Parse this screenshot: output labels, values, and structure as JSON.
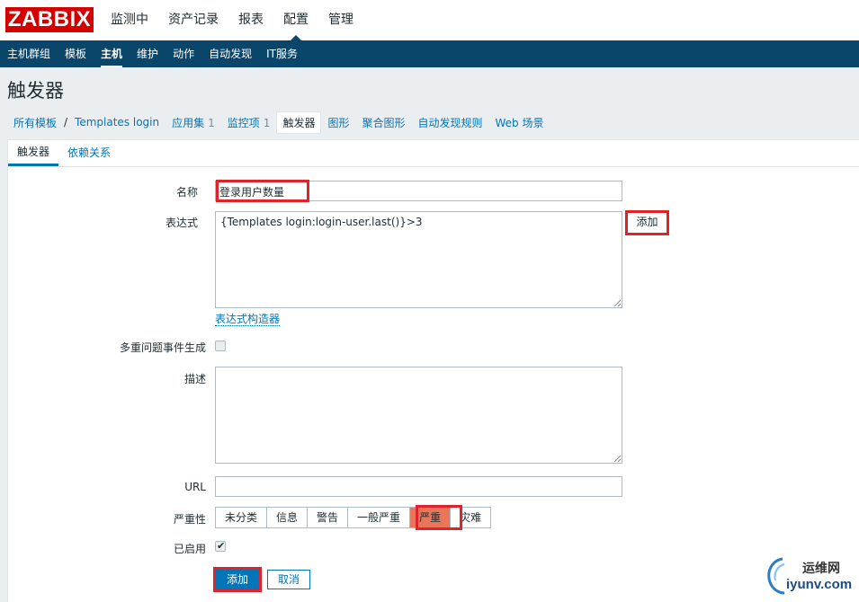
{
  "app": {
    "logo": "ZABBIX"
  },
  "top_nav": [
    "监测中",
    "资产记录",
    "报表",
    "配置",
    "管理"
  ],
  "sub_nav": [
    "主机群组",
    "模板",
    "主机",
    "维护",
    "动作",
    "自动发现",
    "IT服务"
  ],
  "page_title": "触发器",
  "breadcrumbs": {
    "all_templates": "所有模板",
    "template": "Templates login",
    "apps": "应用集",
    "apps_count": "1",
    "items": "监控项",
    "items_count": "1",
    "triggers": "触发器",
    "graphs": "图形",
    "screens": "聚合图形",
    "discovery": "自动发现规则",
    "web": "Web 场景"
  },
  "tabs": [
    "触发器",
    "依赖关系"
  ],
  "form": {
    "name_label": "名称",
    "name_value": "登录用户数量",
    "expression_label": "表达式",
    "expression_value": "{Templates login:login-user.last()}>3",
    "add_expression_button": "添加",
    "expression_builder_link": "表达式构造器",
    "multiple_events_label": "多重问题事件生成",
    "description_label": "描述",
    "url_label": "URL",
    "severity_label": "严重性",
    "severity_options": [
      "未分类",
      "信息",
      "警告",
      "一般严重",
      "严重",
      "灾难"
    ],
    "severity_selected": "严重",
    "enabled_label": "已启用",
    "submit_button": "添加",
    "cancel_button": "取消"
  },
  "watermark": {
    "cn": "运维网",
    "domain": "iyunv.com"
  },
  "colors": {
    "brand_red": "#d40000",
    "nav_blue": "#0a466a",
    "link_blue": "#0275b8",
    "severity_high": "#e97659",
    "highlight_red": "#e0232b"
  }
}
